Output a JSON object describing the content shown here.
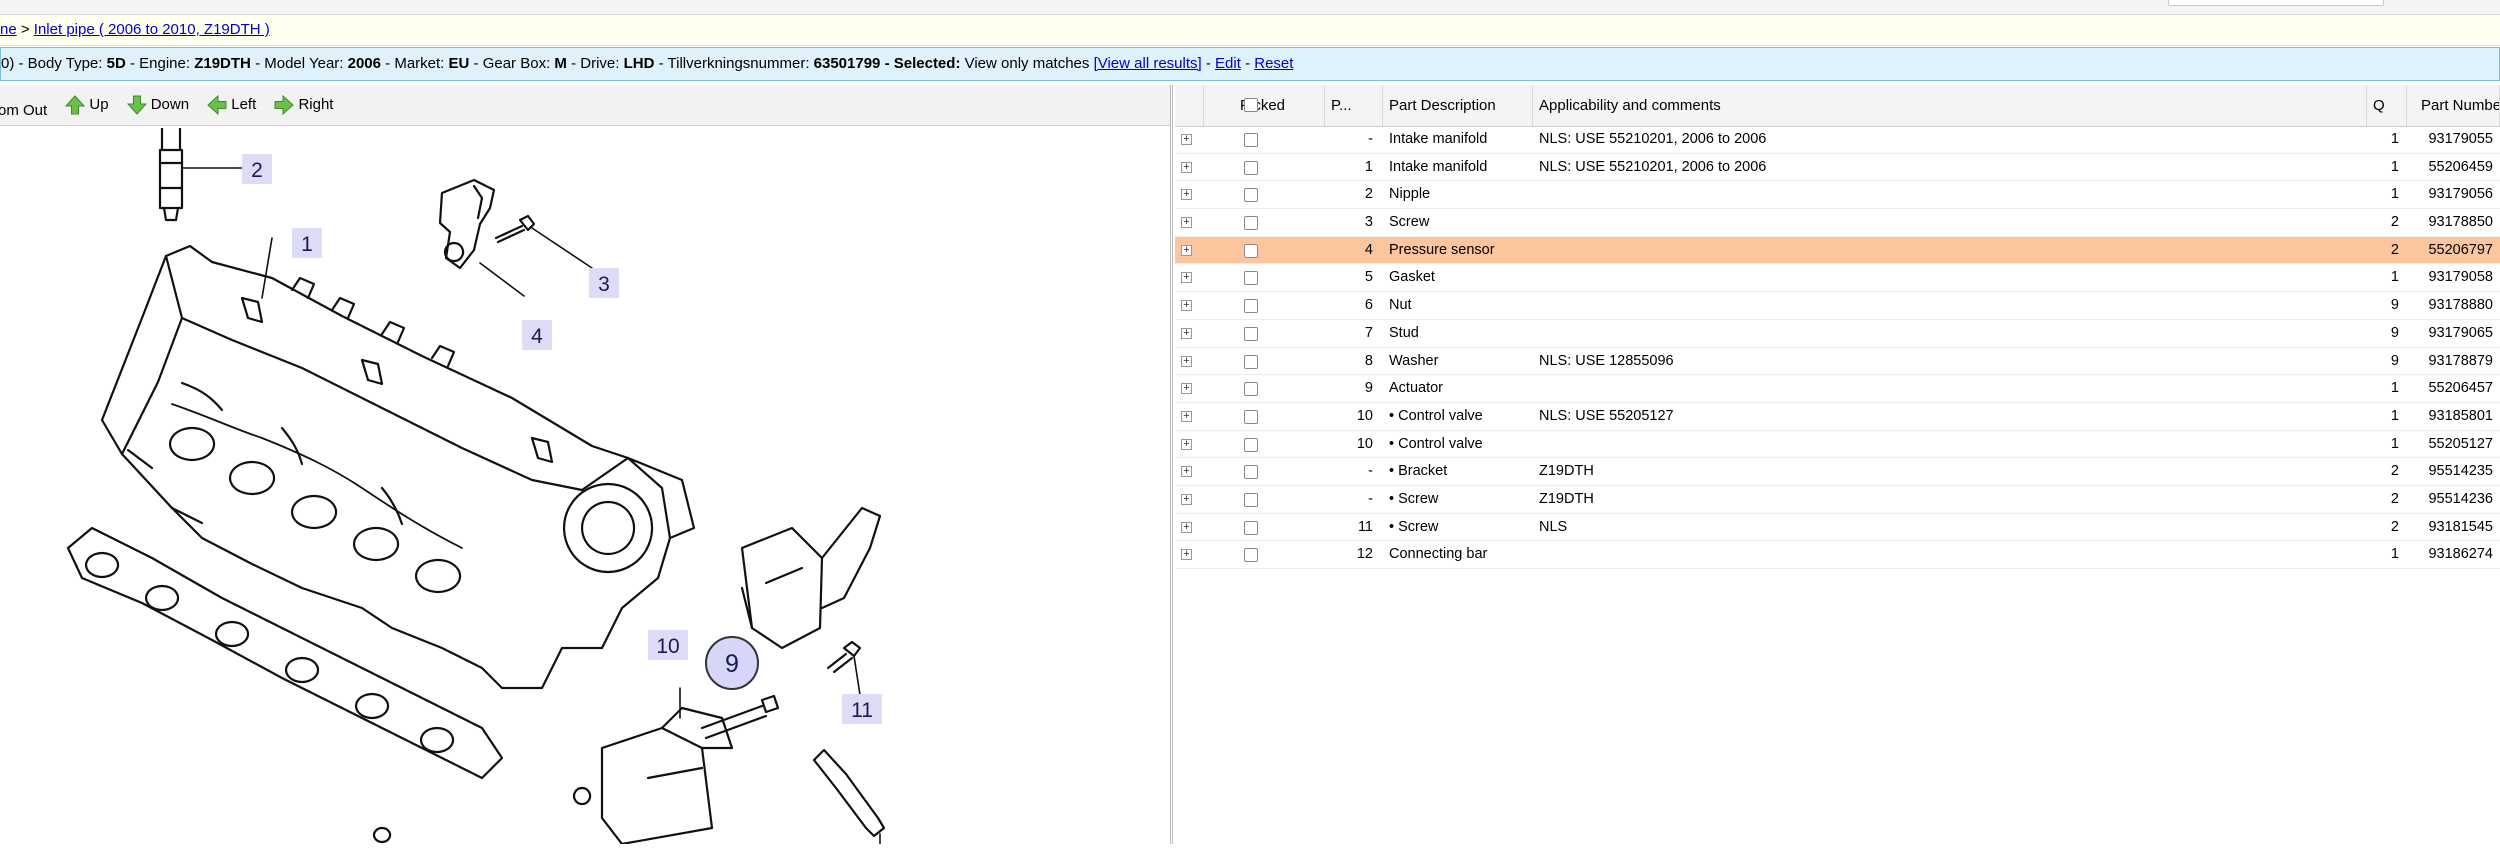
{
  "breadcrumb": {
    "home_fragment": "ne",
    "separator": ">",
    "current": "Inlet pipe ( 2006 to 2010, Z19DTH )"
  },
  "vehicle_info": {
    "prefix": "0) - Body Type:",
    "body_type": "5D",
    "engine_label": "- Engine:",
    "engine": "Z19DTH",
    "model_year_label": "- Model Year:",
    "model_year": "2006",
    "market_label": "- Market:",
    "market": "EU",
    "gearbox_label": "- Gear Box:",
    "gearbox": "M",
    "drive_label": "- Drive:",
    "drive": "LHD",
    "tillv_label": "- Tillverkningsnummer:",
    "tillv": "63501799",
    "selected_label": "- Selected:",
    "selected_text": "View only matches",
    "view_all": "[View all results]",
    "sep1": "-",
    "edit": "Edit",
    "sep2": "-",
    "reset": "Reset"
  },
  "toolbar": {
    "zoom_out": "om Out",
    "up": "Up",
    "down": "Down",
    "left": "Left",
    "right": "Right"
  },
  "drawing_labels": [
    "2",
    "1",
    "3",
    "4",
    "10",
    "9",
    "11"
  ],
  "table": {
    "headers": [
      "Picked",
      "P...",
      "Part Description",
      "Applicability and comments",
      "Q",
      "Part Number"
    ],
    "rows": [
      {
        "pos": "-",
        "desc": "Intake manifold",
        "comment": "NLS: USE 55210201, 2006 to 2006",
        "qty": "1",
        "part": "93179055"
      },
      {
        "pos": "1",
        "desc": "Intake manifold",
        "comment": "NLS: USE 55210201, 2006 to 2006",
        "qty": "1",
        "part": "55206459"
      },
      {
        "pos": "2",
        "desc": "Nipple",
        "comment": "",
        "qty": "1",
        "part": "93179056"
      },
      {
        "pos": "3",
        "desc": "Screw",
        "comment": "",
        "qty": "2",
        "part": "93178850"
      },
      {
        "pos": "4",
        "desc": "Pressure sensor",
        "comment": "",
        "qty": "2",
        "part": "55206797"
      },
      {
        "pos": "5",
        "desc": "Gasket",
        "comment": "",
        "qty": "1",
        "part": "93179058"
      },
      {
        "pos": "6",
        "desc": "Nut",
        "comment": "",
        "qty": "9",
        "part": "93178880"
      },
      {
        "pos": "7",
        "desc": "Stud",
        "comment": "",
        "qty": "9",
        "part": "93179065"
      },
      {
        "pos": "8",
        "desc": "Washer",
        "comment": "NLS: USE 12855096",
        "qty": "9",
        "part": "93178879"
      },
      {
        "pos": "9",
        "desc": "Actuator",
        "comment": "",
        "qty": "1",
        "part": "55206457"
      },
      {
        "pos": "10",
        "desc": "• Control valve",
        "comment": "NLS: USE 55205127",
        "qty": "1",
        "part": "93185801"
      },
      {
        "pos": "10",
        "desc": "• Control valve",
        "comment": "",
        "qty": "1",
        "part": "55205127"
      },
      {
        "pos": "-",
        "desc": "• Bracket",
        "comment": "Z19DTH",
        "qty": "2",
        "part": "95514235"
      },
      {
        "pos": "-",
        "desc": "• Screw",
        "comment": "Z19DTH",
        "qty": "2",
        "part": "95514236"
      },
      {
        "pos": "11",
        "desc": "• Screw",
        "comment": "NLS",
        "qty": "2",
        "part": "93181545"
      },
      {
        "pos": "12",
        "desc": "Connecting bar",
        "comment": "",
        "qty": "1",
        "part": "93186274"
      }
    ],
    "selected_row_color": "#fbc59e",
    "expander_glyph": "+"
  }
}
